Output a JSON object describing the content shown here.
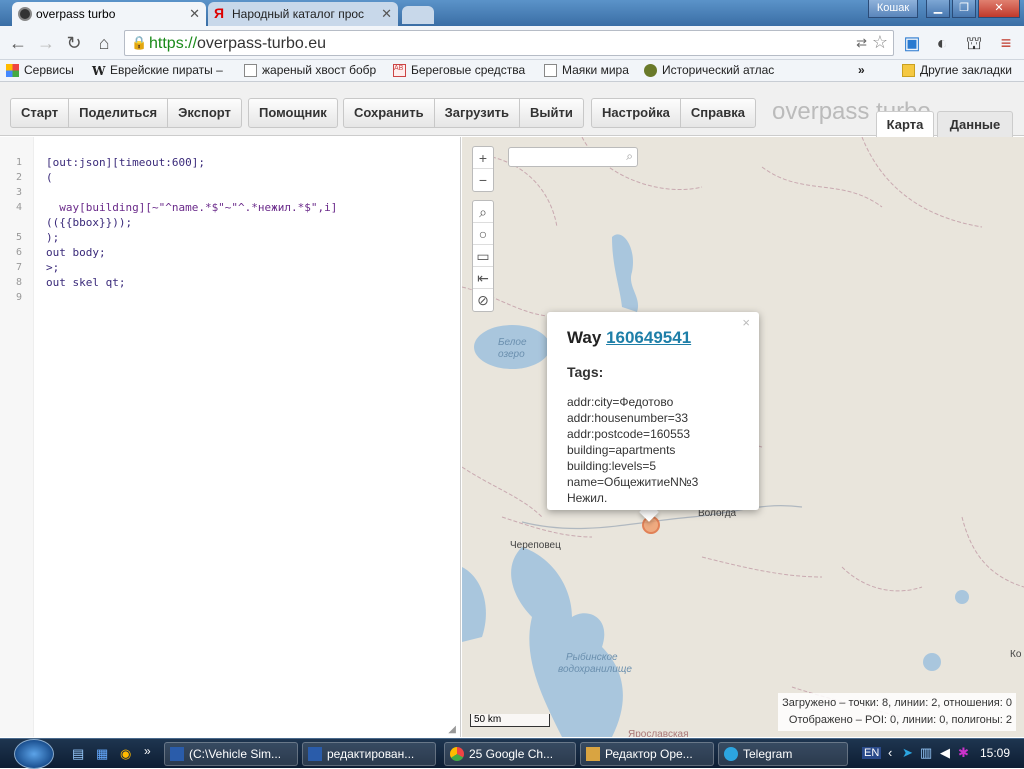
{
  "browser": {
    "tabs": [
      {
        "title": "overpass turbo",
        "active": true
      },
      {
        "title": "Народный каталог прос",
        "active": false
      }
    ],
    "user": "Кошак",
    "url_scheme": "https://",
    "url_host": "overpass-turbo.eu",
    "bookmarks": [
      {
        "label": "Сервисы",
        "icon": "apps-icon"
      },
      {
        "label": "Еврейские пираты –",
        "icon": "wikipedia-icon"
      },
      {
        "label": "жареный хвост бобр",
        "icon": "page-icon"
      },
      {
        "label": "Береговые средства",
        "icon": "abc-icon"
      },
      {
        "label": "Маяки мира",
        "icon": "page-icon"
      },
      {
        "label": "Исторический атлас",
        "icon": "atlas-icon"
      }
    ],
    "bookmarks_more": "»",
    "other_bookmarks": "Другие закладки"
  },
  "app": {
    "brand": "overpass turbo",
    "buttons": {
      "run": "Старт",
      "share": "Поделиться",
      "export": "Экспорт",
      "wizard": "Помощник",
      "save": "Сохранить",
      "load": "Загрузить",
      "exit": "Выйти",
      "settings": "Настройка",
      "help": "Справка"
    },
    "view_tabs": {
      "map": "Карта",
      "data": "Данные"
    }
  },
  "editor": {
    "line_numbers": [
      "1",
      "2",
      "3",
      "4",
      "",
      "5",
      "6",
      "7",
      "8",
      "9"
    ],
    "lines": [
      "[out:json][timeout:600];",
      "(",
      "",
      "  way[building][~\"^name.*$\"~\"^.*нежил.*$\",i]",
      "(({{bbox}}));",
      ");",
      "out body;",
      ">;",
      "out skel qt;",
      ""
    ]
  },
  "map": {
    "popup": {
      "type_label": "Way",
      "id": "160649541",
      "tags_heading": "Tags:",
      "tags": [
        "addr:city=Федотово",
        "addr:housenumber=33",
        "addr:postcode=160553",
        "building=apartments",
        "building:levels=5",
        "name=ОбщежитиеN№3 Нежил."
      ],
      "close": "×"
    },
    "labels": {
      "beloe_1": "Белое",
      "beloe_2": "озеро",
      "cherepovets": "Череповец",
      "vologda": "Вологда",
      "rybinsk_1": "Рыбинское",
      "rybinsk_2": "водохранилище",
      "yaroslavl": "Ярославская",
      "edge_k": "Ко"
    },
    "scale": "50 km",
    "stats_loaded": "Загружено – точки: 8, линии: 2, отношения: 0",
    "stats_shown": "Отображено – POI: 0, линии: 0, полигоны: 2",
    "controls": [
      "+",
      "−"
    ],
    "tools": [
      "search-icon",
      "locate-icon",
      "image-icon",
      "zoom-data-icon",
      "clear-icon"
    ]
  },
  "taskbar": {
    "tasks": [
      "(C:\\Vehicle Sim...",
      "редактирован...",
      "25 Google Ch...",
      "Редактор Оре...",
      "Telegram"
    ],
    "lang": "EN",
    "time": "15:09"
  },
  "colors": {
    "water": "#a9c6dd",
    "accent": "#1e7fa8",
    "marker": "#f0a070"
  }
}
